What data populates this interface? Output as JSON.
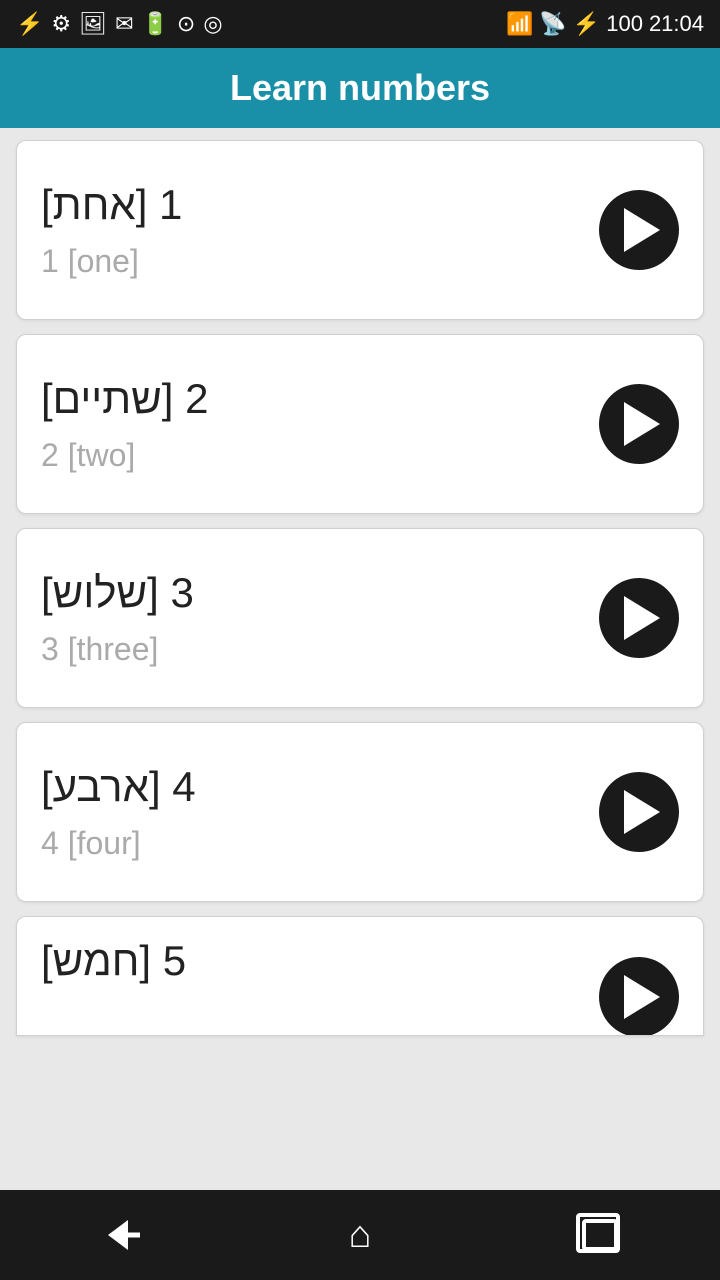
{
  "statusBar": {
    "time": "21:04",
    "batteryLevel": "100"
  },
  "header": {
    "title": "Learn numbers"
  },
  "cards": [
    {
      "id": 1,
      "primary": "1 [אחת]",
      "secondary": "1 [one]"
    },
    {
      "id": 2,
      "primary": "2 [שתיים]",
      "secondary": "2 [two]"
    },
    {
      "id": 3,
      "primary": "3 [שלוש]",
      "secondary": "3 [three]"
    },
    {
      "id": 4,
      "primary": "4 [ארבע]",
      "secondary": "4 [four]"
    },
    {
      "id": 5,
      "primary": "5 [חמש]",
      "secondary": ""
    }
  ],
  "nav": {
    "back": "back",
    "home": "home",
    "recents": "recents"
  }
}
